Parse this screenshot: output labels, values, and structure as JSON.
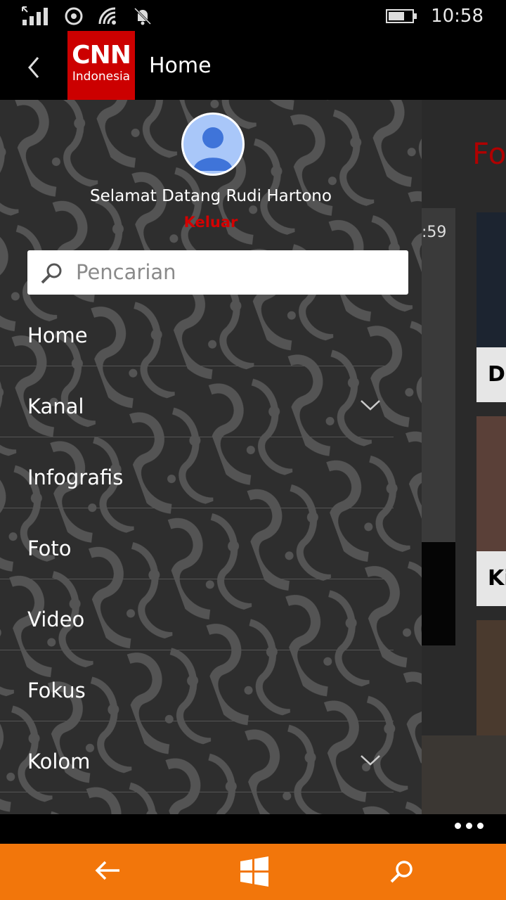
{
  "status_bar": {
    "time": "10:58",
    "icons": [
      "signal-icon",
      "sync-icon",
      "wifi-icon",
      "notification-bell-icon",
      "battery-icon"
    ]
  },
  "header": {
    "title": "Home",
    "logo_main": "CNN",
    "logo_sub": "Indonesia"
  },
  "drawer": {
    "welcome": "Selamat Datang Rudi Hartono",
    "logout": "Keluar",
    "search_placeholder": "Pencarian",
    "items": [
      {
        "label": "Home",
        "expandable": false
      },
      {
        "label": "Kanal",
        "expandable": true
      },
      {
        "label": "Infografis",
        "expandable": false
      },
      {
        "label": "Foto",
        "expandable": false
      },
      {
        "label": "Video",
        "expandable": false
      },
      {
        "label": "Fokus",
        "expandable": false
      },
      {
        "label": "Kolom",
        "expandable": true
      }
    ]
  },
  "background_content": {
    "section_title_partial": "Fo",
    "video_time_partial": ":59",
    "card1_caption_partial": "D",
    "card2_caption_partial": "Ki"
  },
  "colors": {
    "accent_orange": "#f2760b",
    "cnn_red": "#cc0000",
    "logout_red": "#d40000",
    "drawer_bg": "#2e2e2e"
  }
}
